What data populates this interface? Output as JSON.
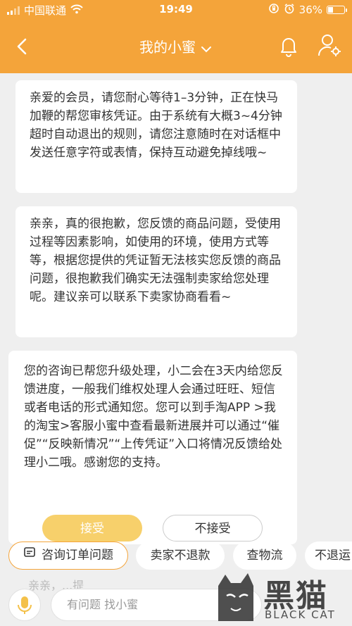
{
  "status_bar": {
    "carrier": "中国联通",
    "time": "19:49",
    "battery": "36%",
    "battery_level": 0.36
  },
  "header": {
    "title": "我的小蜜"
  },
  "messages": [
    {
      "text": "亲爱的会员，请您耐心等待1–3分钟，正在快马加鞭的帮您审核凭证。由于系统有大概3~4分钟超时自动退出的规则，请您注意随时在对话框中发送任意字符或表情，保持互动避免掉线哦~"
    },
    {
      "text": "亲亲，真的很抱歉，您反馈的商品问题，受使用过程等因素影响，如使用的环境，使用方式等等，根据您提供的凭证暂无法核实您反馈的商品问题，很抱歉我们确实无法强制卖家给您处理呢。建议亲可以联系下卖家协商看看~"
    },
    {
      "text": "您的咨询已帮您升级处理，小二会在3天内给您反馈进度，一般我们维权处理人会通过旺旺、短信或者电话的形式通知您。您可以到手淘APP >我的淘宝>客服小蜜中查看最新进展并可以通过“催促”“反映新情况”“上传凭证”入口将情况反馈给处理小二哦。感谢您的支持。"
    }
  ],
  "actions": {
    "accept": "接受",
    "reject": "不接受"
  },
  "quick_replies": [
    "咨询订单问题",
    "卖家不退款",
    "查物流",
    "不退运"
  ],
  "input": {
    "placeholder": "有问题 找小蜜"
  },
  "hidden_text": "亲亲，...提",
  "watermark": {
    "cn": "黑猫",
    "en": "BLACK CAT"
  },
  "colors": {
    "accent": "#f4a43a",
    "accept_button": "#f7d06b",
    "background": "#efefef"
  }
}
